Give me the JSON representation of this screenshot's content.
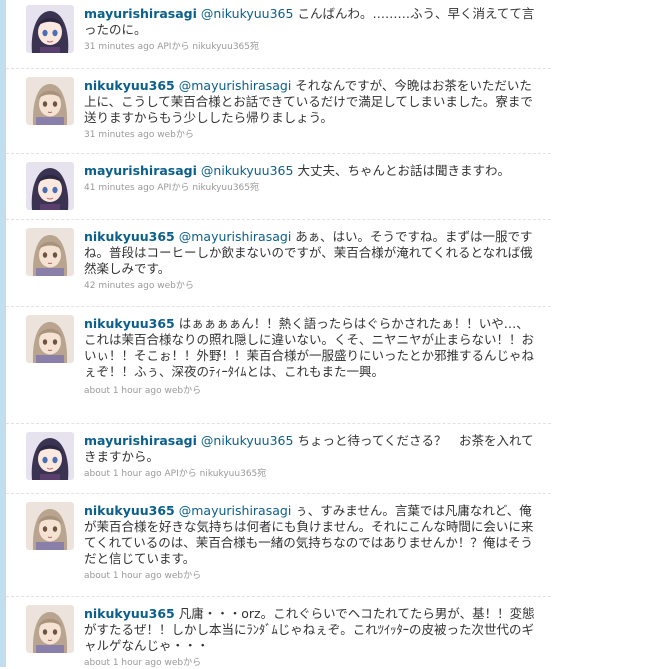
{
  "colors": {
    "link": "#0a5f8c",
    "text": "#333333",
    "meta": "#999999",
    "sidebar_accent": "#c0deed"
  },
  "tweets": [
    {
      "user": "mayurishirasagi",
      "mention": "@nikukyuu365",
      "text": " こんばんわ。………ふう、早く消えてて言ったのに。",
      "time": "31 minutes ago",
      "source_prefix": " ",
      "source": "APIから",
      "reply_to": "nikukyuu365宛",
      "avatar": "girl-dark-hair-avatar"
    },
    {
      "user": "nikukyuu365",
      "mention": "@mayurishirasagi",
      "text": " それなんですが、今晩はお茶をいただいた上に、こうして茉百合様とお話できているだけで満足してしまいました。寮まで送りますからもう少ししたら帰りましょう。",
      "time": "31 minutes ago",
      "source_prefix": " ",
      "source": "webから",
      "reply_to": "",
      "avatar": "boy-light-hair-avatar"
    },
    {
      "user": "mayurishirasagi",
      "mention": "@nikukyuu365",
      "text": " 大丈夫、ちゃんとお話は聞きますわ。",
      "time": "41 minutes ago",
      "source_prefix": " ",
      "source": "APIから",
      "reply_to": "nikukyuu365宛",
      "avatar": "girl-dark-hair-avatar"
    },
    {
      "user": "nikukyuu365",
      "mention": "@mayurishirasagi",
      "text": " あぁ、はい。そうですね。まずは一服ですね。普段はコーヒーしか飲まないのですが、茉百合様が淹れてくれるとなれば俄然楽しみです。",
      "time": "42 minutes ago",
      "source_prefix": " ",
      "source": "webから",
      "reply_to": "",
      "avatar": "boy-light-hair-avatar"
    },
    {
      "user": "nikukyuu365",
      "mention": "",
      "text": " はぁぁぁぁん！！熱く語ったらはぐらかされたぁ！！いや…、これは茉百合様なりの照れ隠しに違いない。くそ、ニヤニヤが止まらない！！おいぃ！！そこぉ！！外野！！茉百合様が一服盛りにいったとか邪推するんじゃねぇぞ！！ふぅ、深夜のﾃｨｰﾀｲﾑとは、これもまた一興。",
      "time": "about 1 hour ago",
      "source_prefix": " ",
      "source": "webから",
      "reply_to": "",
      "avatar": "boy-light-hair-avatar"
    },
    {
      "user": "mayurishirasagi",
      "mention": "@nikukyuu365",
      "text": " ちょっと待ってくださる？　お茶を入れてきますから。",
      "time": "about 1 hour ago",
      "source_prefix": " ",
      "source": "APIから",
      "reply_to": "nikukyuu365宛",
      "avatar": "girl-dark-hair-avatar"
    },
    {
      "user": "nikukyuu365",
      "mention": "@mayurishirasagi",
      "text": " ぅ、すみません。言葉では凡庸なれど、俺が茉百合様を好きな気持ちは何者にも負けません。それにこんな時間に会いに来てくれているのは、茉百合様も一緒の気持ちなのではありませんか！？俺はそうだと信じています。",
      "time": "about 1 hour ago",
      "source_prefix": " ",
      "source": "webから",
      "reply_to": "",
      "avatar": "boy-light-hair-avatar"
    },
    {
      "user": "nikukyuu365",
      "mention": "",
      "text": " 凡庸・・・orz。これぐらいでヘコたれてたら男が、基！！変態がすたるぜ！！しかし本当にﾗﾝﾀﾞﾑじゃねぇぞ。これﾂｲｯﾀｰの皮被った次世代のギャルゲなんじゃ・・・",
      "time": "about 1 hour ago",
      "source_prefix": " ",
      "source": "webから",
      "reply_to": "",
      "avatar": "boy-light-hair-avatar"
    }
  ]
}
